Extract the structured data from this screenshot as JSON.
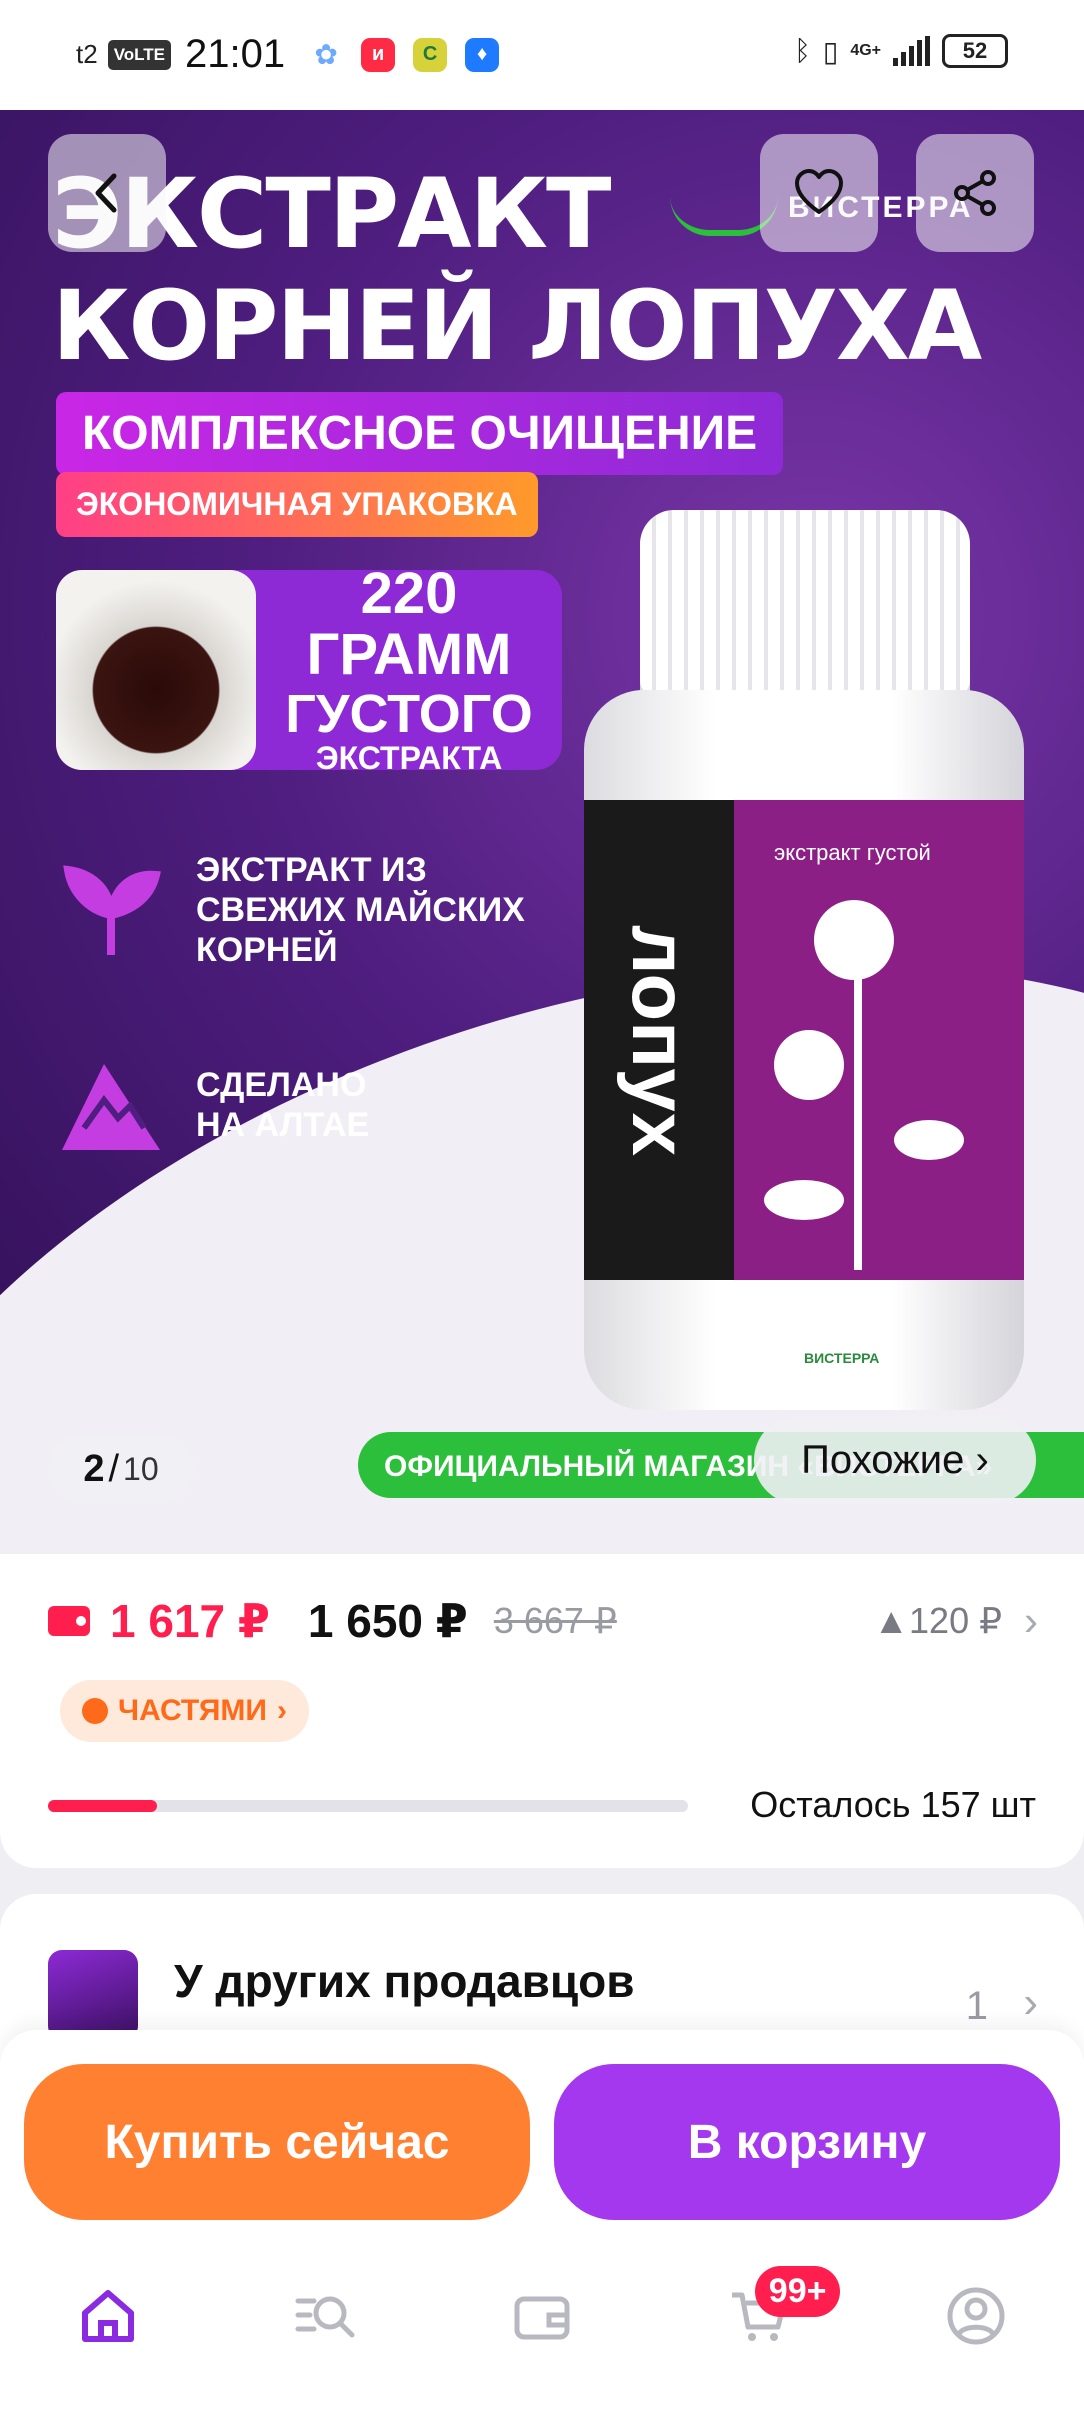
{
  "status_bar": {
    "carrier": "t2",
    "volte": "VoLTE",
    "time": "21:01",
    "app_icons": [
      {
        "name": "grid-app-icon",
        "color": "#6fa8ff",
        "glyph": "✿"
      },
      {
        "name": "red-app-icon",
        "color": "#ff2a44",
        "glyph": "и"
      },
      {
        "name": "yellow-app-icon",
        "color": "#d7d23a",
        "glyph": "С"
      },
      {
        "name": "blue-app-icon",
        "color": "#1e7bff",
        "glyph": "♦"
      }
    ],
    "network": "4G+",
    "battery": "52"
  },
  "hero": {
    "title_line1": "ЭКСТРАКТ",
    "title_line2": "КОРНЕЙ ЛОПУХА",
    "pill1": "КОМПЛЕКСНОЕ ОЧИЩЕНИЕ",
    "pill2": "ЭКОНОМИЧНАЯ УПАКОВКА",
    "grams_line1": "220 ГРАММ",
    "grams_line2": "ГУСТОГО",
    "grams_line3": "ЭКСТРАКТА",
    "feature1": [
      "ЭКСТРАКТ ИЗ",
      "СВЕЖИХ МАЙСКИХ",
      "КОРНЕЙ"
    ],
    "feature2": [
      "СДЕЛАНО",
      "НА АЛТАЕ"
    ],
    "bottle_label": "лопух",
    "bottle_subtitle": "экстракт густой",
    "bottle_brand": "ВИСТЕРРА",
    "brand": "ВИСТЕРРА",
    "green_banner": "ОФИЦИАЛЬНЫЙ МАГАЗИН «ВИСТЕРРА»",
    "pager_current": "2",
    "pager_separator": "/",
    "pager_total": "10",
    "similar_label": "Похожие ›"
  },
  "price": {
    "wallet_price": "1 617 ₽",
    "price": "1 650 ₽",
    "old_price": "3 667 ₽",
    "delta": "▲120 ₽",
    "installment_label": "ЧАСТЯМИ",
    "installment_chevron": "›",
    "stock_fraction": 0.17,
    "stock_text": "Осталось 157 шт",
    "accent": "#ff1e4d"
  },
  "sellers": {
    "title": "У других продавцов",
    "count": "1",
    "chevron": "›"
  },
  "actions": {
    "buy_label": "Купить сейчас",
    "cart_label": "В корзину",
    "buy_color": "#ff8030",
    "cart_color": "#a338ee"
  },
  "nav": {
    "cart_badge": "99+",
    "items": [
      "home-icon",
      "catalog-search-icon",
      "wallet-icon",
      "cart-icon",
      "profile-icon"
    ]
  }
}
